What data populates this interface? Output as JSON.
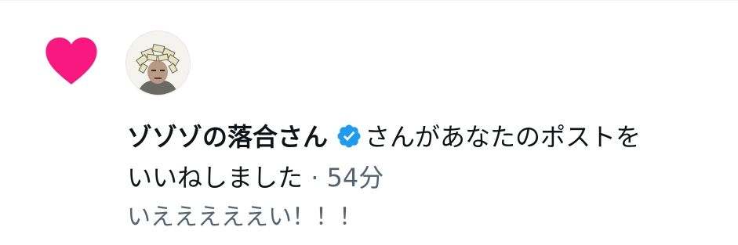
{
  "notification": {
    "type_icon": "heart-icon",
    "avatar_icon": "avatar-image",
    "display_name": "ゾゾゾの落合さん",
    "verified": true,
    "action_text_line1": "さんがあなたのポストを",
    "action_text_line2": "いいねしました",
    "separator": "·",
    "time": "54分",
    "post_excerpt": "いえええええい！！！"
  },
  "colors": {
    "like_pink": "#f91880",
    "verified_blue": "#1d9bf0",
    "text_primary": "#0f1419",
    "text_secondary": "#536471"
  }
}
